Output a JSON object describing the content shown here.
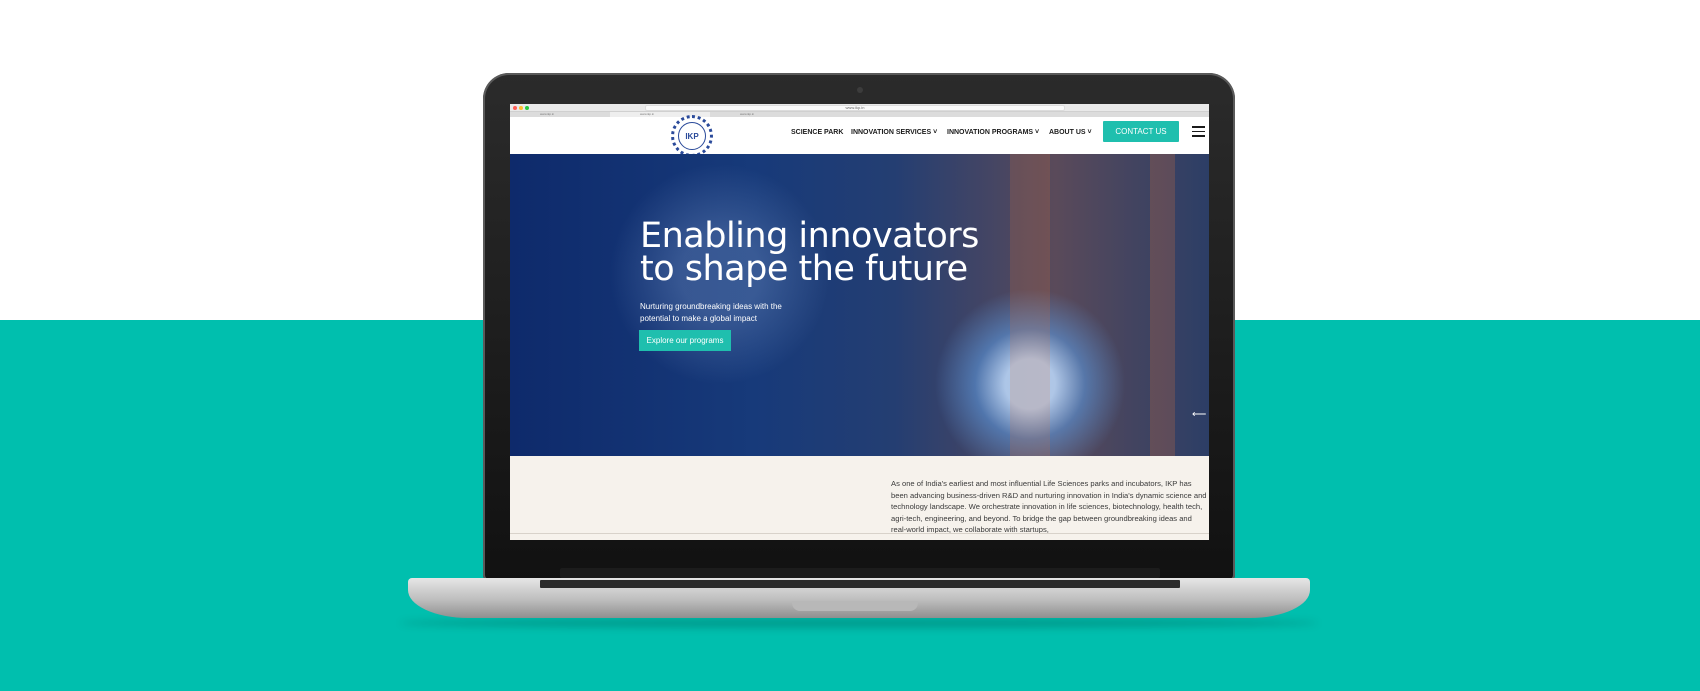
{
  "browser": {
    "url": "www.ikp.in",
    "tabs": [
      "www.ikp.in",
      "www.ikp.in",
      "www.ikp.in"
    ]
  },
  "nav": {
    "logo_text": "IKP",
    "items": [
      {
        "label": "SCIENCE PARK"
      },
      {
        "label": "INNOVATION SERVICES"
      },
      {
        "label": "INNOVATION PROGRAMS"
      },
      {
        "label": "ABOUT US"
      }
    ],
    "contact_label": "CONTACT US"
  },
  "hero": {
    "title": "Enabling innovators to shape the future",
    "subtitle": "Nurturing groundbreaking ideas with the potential to make a global impact",
    "button_label": "Explore our programs"
  },
  "about": {
    "text": "As one of India's earliest and most influential Life Sciences parks and incubators, IKP has been advancing business-driven R&D and nurturing innovation in India's dynamic science and technology landscape. We orchestrate innovation in life sciences, biotechnology, health tech, agri-tech, engineering, and beyond. To bridge the gap between groundbreaking ideas and real-world impact, we collaborate with startups,"
  },
  "colors": {
    "accent": "#1fbfae",
    "background_band": "#00bfae",
    "hero_dark": "#0e2a6b"
  }
}
